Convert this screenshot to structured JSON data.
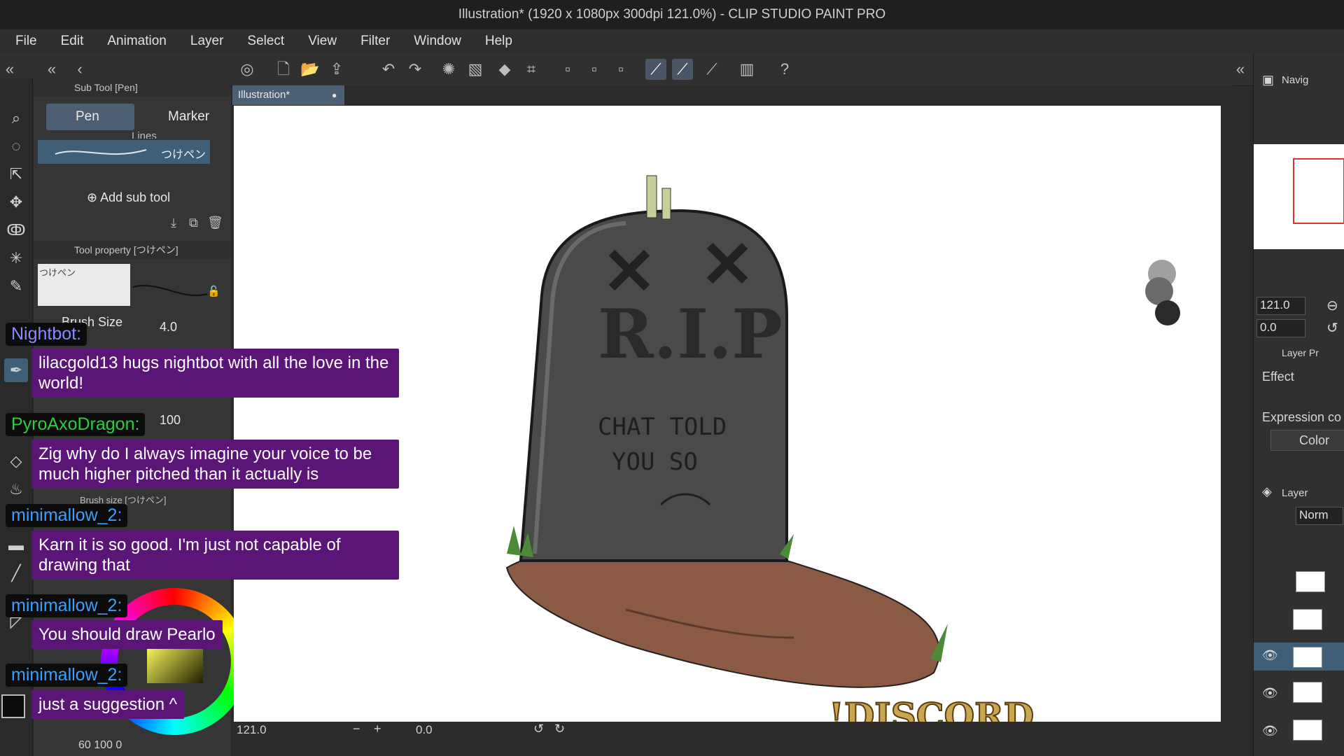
{
  "window": {
    "title": "Illustration* (1920 x 1080px 300dpi 121.0%)  - CLIP STUDIO PAINT PRO"
  },
  "menu": [
    "File",
    "Edit",
    "Animation",
    "Layer",
    "Select",
    "View",
    "Filter",
    "Window",
    "Help"
  ],
  "subtool_panel": {
    "header": "Sub Tool [Pen]",
    "tabs": [
      "Pen",
      "Marker"
    ],
    "group_label": "Lines",
    "brush_name": "つけペン",
    "add_sub_tool": "Add sub tool"
  },
  "tool_property": {
    "header": "Tool property [つけペン]",
    "preview_name": "つけペン",
    "brush_size_label": "Brush Size",
    "brush_size_value": "4.0",
    "opacity_value": "100",
    "brush_size_panel": "Brush size [つけペン]"
  },
  "color_indicator": {
    "h": "60",
    "s": "100",
    "v": "0"
  },
  "document": {
    "tab_label": "Illustration*"
  },
  "artwork": {
    "headstone_text": "R.I.P",
    "epitaph_line1": "CHAT TOLD",
    "epitaph_line2": "YOU SO",
    "overlay_text": "!DISCORD"
  },
  "status_bar": {
    "zoom": "121.0",
    "rotation": "0.0"
  },
  "navigator": {
    "title": "Navig",
    "zoom": "121.0",
    "rotation": "0.0"
  },
  "layer_property": {
    "title": "Layer Pr",
    "effect": "Effect",
    "expression": "Expression co",
    "color_button": "Color"
  },
  "layer_panel": {
    "title": "Layer",
    "blend_mode": "Norm"
  },
  "chat": [
    {
      "user": "Nightbot:",
      "user_color": "#8a8aff",
      "message": "lilacgold13 hugs nightbot with all the love in the world!"
    },
    {
      "user": "PyroAxoDragon:",
      "user_color": "#2ecc40",
      "message": "Zig why do I always imagine your voice to be much higher pitched than it actually is"
    },
    {
      "user": "minimallow_2:",
      "user_color": "#3aa0ff",
      "message": "Karn it is so good. I'm just not capable of drawing that"
    },
    {
      "user": "minimallow_2:",
      "user_color": "#3aa0ff",
      "message": "You should draw Pearlo"
    },
    {
      "user": "minimallow_2:",
      "user_color": "#3aa0ff",
      "message": "just a suggestion ^"
    }
  ],
  "colors": {
    "accent_tab": "#4d5f73",
    "chat_bubble": "#5a1577",
    "headstone": "#4a4a4a",
    "dirt": "#8a5a44",
    "discord_text": "#c9a652"
  }
}
